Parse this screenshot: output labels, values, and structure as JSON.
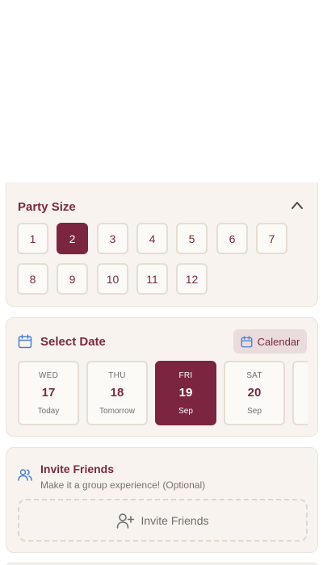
{
  "party_size": {
    "title": "Party Size",
    "options": [
      "1",
      "2",
      "3",
      "4",
      "5",
      "6",
      "7",
      "8",
      "9",
      "10",
      "11",
      "12"
    ],
    "selected": "2",
    "collapse_icon": "chevron-up-icon"
  },
  "select_date": {
    "title": "Select Date",
    "title_icon": "calendar-icon",
    "calendar_button_label": "Calendar",
    "days": [
      {
        "dow": "WED",
        "day": "17",
        "sub": "Today"
      },
      {
        "dow": "THU",
        "day": "18",
        "sub": "Tomorrow"
      },
      {
        "dow": "FRI",
        "day": "19",
        "sub": "Sep",
        "selected": true
      },
      {
        "dow": "SAT",
        "day": "20",
        "sub": "Sep"
      }
    ]
  },
  "invite": {
    "title": "Invite Friends",
    "subtitle": "Make it a group experience! (Optional)",
    "title_icon": "users-icon",
    "button_label": "Invite Friends",
    "button_icon": "user-plus-icon"
  },
  "colors": {
    "accent": "#7b2540",
    "card_bg": "#f8f3ee",
    "icon_blue": "#4a7fd6"
  }
}
